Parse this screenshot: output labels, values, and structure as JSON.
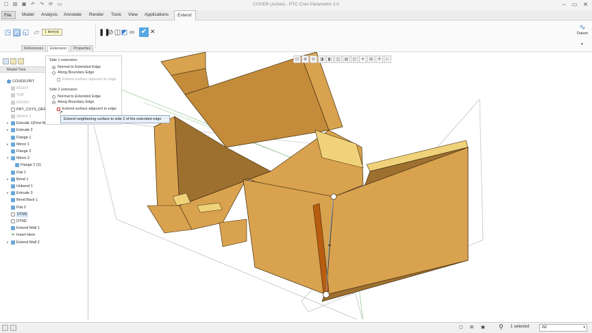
{
  "window": {
    "title": "COVER (Active) - PTC Creo Parametric 3.0"
  },
  "menubar": {
    "file": "File",
    "items": [
      "Model",
      "Analysis",
      "Annotate",
      "Render",
      "Tools",
      "View",
      "Applications"
    ],
    "active_tab": "Extend"
  },
  "ribbon": {
    "items_selected": "1 item(s)",
    "datum_label": "Datum"
  },
  "dashboard_tabs": [
    "References",
    "Extension",
    "Properties"
  ],
  "model_tree": {
    "header": "Model Tree",
    "rows": [
      {
        "label": "COVER.PRT",
        "indent": 0,
        "toggle": "",
        "icon": "part",
        "gray": false,
        "hl": false
      },
      {
        "label": "RIGHT",
        "indent": 1,
        "toggle": "",
        "icon": "gray",
        "gray": true,
        "hl": false
      },
      {
        "label": "TOP",
        "indent": 1,
        "toggle": "",
        "icon": "gray",
        "gray": true,
        "hl": false
      },
      {
        "label": "FRONT",
        "indent": 1,
        "toggle": "",
        "icon": "gray",
        "gray": true,
        "hl": false
      },
      {
        "label": "PRT_CSYS_DEF",
        "indent": 1,
        "toggle": "",
        "icon": "datum",
        "gray": false,
        "hl": false
      },
      {
        "label": "Sketch 1",
        "indent": 1,
        "toggle": "",
        "icon": "gray",
        "gray": true,
        "hl": false
      },
      {
        "label": "Extrude 1(First Wall)",
        "indent": 1,
        "toggle": "▸",
        "icon": "feat",
        "gray": false,
        "hl": false
      },
      {
        "label": "Extrude 2",
        "indent": 1,
        "toggle": "▸",
        "icon": "feat",
        "gray": false,
        "hl": false
      },
      {
        "label": "Flange 1",
        "indent": 1,
        "toggle": "",
        "icon": "feat",
        "gray": false,
        "hl": false
      },
      {
        "label": "Mirror 1",
        "indent": 1,
        "toggle": "▸",
        "icon": "feat",
        "gray": false,
        "hl": false
      },
      {
        "label": "Flange 2",
        "indent": 1,
        "toggle": "",
        "icon": "feat",
        "gray": false,
        "hl": false
      },
      {
        "label": "Mirror 2",
        "indent": 1,
        "toggle": "▾",
        "icon": "feat",
        "gray": false,
        "hl": false
      },
      {
        "label": "Flange 2 (2)",
        "indent": 2,
        "toggle": "",
        "icon": "feat",
        "gray": false,
        "hl": false
      },
      {
        "label": "Flat 1",
        "indent": 1,
        "toggle": "",
        "icon": "feat",
        "gray": false,
        "hl": false
      },
      {
        "label": "Bend 1",
        "indent": 1,
        "toggle": "▸",
        "icon": "feat",
        "gray": false,
        "hl": false
      },
      {
        "label": "Unbend 1",
        "indent": 1,
        "toggle": "",
        "icon": "feat",
        "gray": false,
        "hl": false
      },
      {
        "label": "Extrude 3",
        "indent": 1,
        "toggle": "▸",
        "icon": "feat",
        "gray": false,
        "hl": false
      },
      {
        "label": "Bend Back 1",
        "indent": 1,
        "toggle": "",
        "icon": "feat",
        "gray": false,
        "hl": false
      },
      {
        "label": "Flat 2",
        "indent": 1,
        "toggle": "",
        "icon": "feat",
        "gray": false,
        "hl": false
      },
      {
        "label": "DTM1",
        "indent": 1,
        "toggle": "",
        "icon": "datum",
        "gray": false,
        "hl": true
      },
      {
        "label": "DTM2",
        "indent": 1,
        "toggle": "",
        "icon": "datum",
        "gray": false,
        "hl": false
      },
      {
        "label": "Extend Wall 1",
        "indent": 1,
        "toggle": "",
        "icon": "feat",
        "gray": false,
        "hl": false
      },
      {
        "label": "Insert Here",
        "indent": 1,
        "toggle": "",
        "icon": "insert",
        "gray": false,
        "hl": false
      },
      {
        "label": "Extend Wall 2",
        "indent": 1,
        "toggle": "▸",
        "icon": "feat",
        "gray": false,
        "hl": false
      }
    ]
  },
  "extension_panel": {
    "side1_title": "Side 1 extension",
    "side1_opt1": "Normal to Extended Edge",
    "side1_opt2": "Along Boundary Edge",
    "side1_check": "Extend surface adjacent to edge",
    "side2_title": "Side 2 extension",
    "side2_opt1": "Normal to Extended Edge",
    "side2_opt2": "Along Boundary Edge",
    "side2_check": "Extend surface adjacent to edge"
  },
  "tooltip": "Extend neighboring surface to side 2 of the extended edge",
  "statusbar": {
    "selected": "1 selected",
    "filter": "All"
  },
  "colors": {
    "part_face": "#d9a24e",
    "part_edge": "#3d2a10",
    "datum_plane": "#9ac99a",
    "accent": "#57a8e0"
  }
}
